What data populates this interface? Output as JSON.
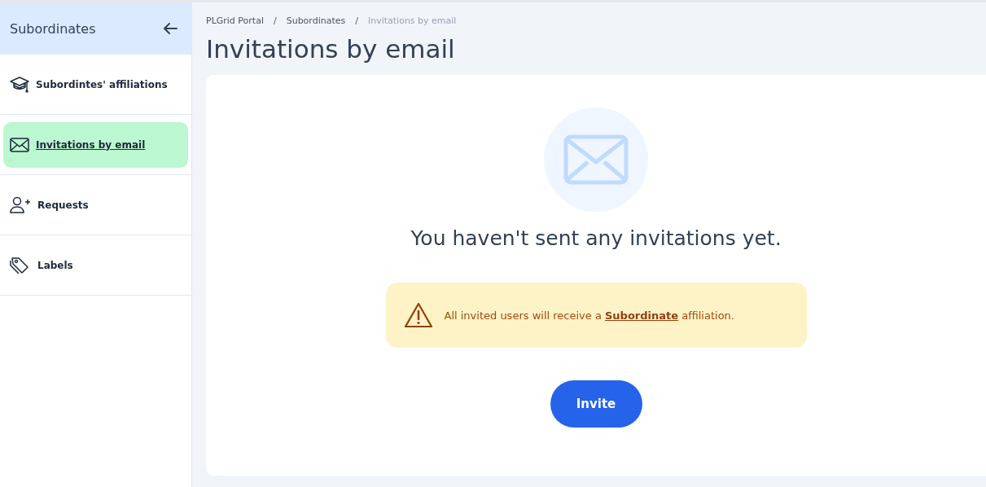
{
  "sidebar": {
    "title": "Subordinates",
    "items": [
      {
        "label": "Subordintes' affiliations",
        "selected": false
      },
      {
        "label": "Invitations by email",
        "selected": true
      },
      {
        "label": "Requests",
        "selected": false
      },
      {
        "label": "Labels",
        "selected": false
      }
    ]
  },
  "breadcrumbs": [
    {
      "label": "PLGrid Portal",
      "current": false
    },
    {
      "label": "Subordinates",
      "current": false
    },
    {
      "label": "Invitations by email",
      "current": true
    }
  ],
  "breadcrumb_separator": "/",
  "page_title": "Invitations by email",
  "empty_state": {
    "message": "You haven't sent any invitations yet."
  },
  "notice": {
    "text_before": "All invited users will receive a",
    "link": "Subordinate",
    "text_after": "affiliation."
  },
  "buttons": [
    "Invite"
  ]
}
